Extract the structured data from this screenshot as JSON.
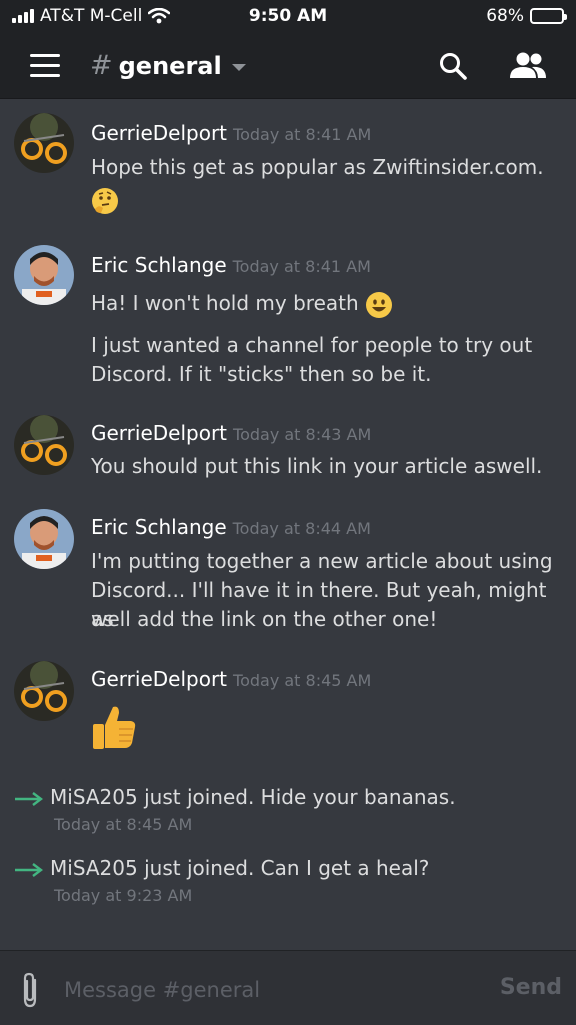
{
  "status_bar": {
    "carrier": "AT&T M-Cell",
    "time": "9:50 AM",
    "battery": "68%",
    "battery_level": 0.68
  },
  "header": {
    "hash": "#",
    "channel": "general"
  },
  "messages": [
    {
      "author": "GerrieDelport",
      "time": "Today at 8:41 AM",
      "lines": [
        "Hope this get as popular as Zwiftinsider.com."
      ],
      "emoji": "thinking-face"
    },
    {
      "author": "Eric Schlange",
      "time": "Today at 8:41 AM",
      "lines": [
        "Ha! I won't hold my breath",
        "I just wanted a channel for people to try out",
        "Discord. If it \"sticks\" then so be it."
      ],
      "emoji": "smiley-face"
    },
    {
      "author": "GerrieDelport",
      "time": "Today at 8:43 AM",
      "lines": [
        "You should put this link in your article aswell."
      ]
    },
    {
      "author": "Eric Schlange",
      "time": "Today at 8:44 AM",
      "lines": [
        "I'm putting together a new article about using",
        "Discord... I'll have it in there. But yeah, might as",
        "well add the link on the other one!"
      ]
    },
    {
      "author": "GerrieDelport",
      "time": "Today at 8:45 AM",
      "lines": [],
      "emoji": "thumbs-up"
    }
  ],
  "joins": [
    {
      "user": "MiSA205",
      "text": "just joined. Hide your bananas.",
      "time": "Today at 8:45 AM"
    },
    {
      "user": "MiSA205",
      "text": "just joined. Can I get a heal?",
      "time": "Today at 9:23 AM"
    }
  ],
  "composer": {
    "placeholder": "Message #general",
    "send_label": "Send"
  },
  "colors": {
    "background": "#36393f",
    "header": "#202225",
    "join_arrow": "#43b581",
    "timestamp": "#72767d"
  }
}
